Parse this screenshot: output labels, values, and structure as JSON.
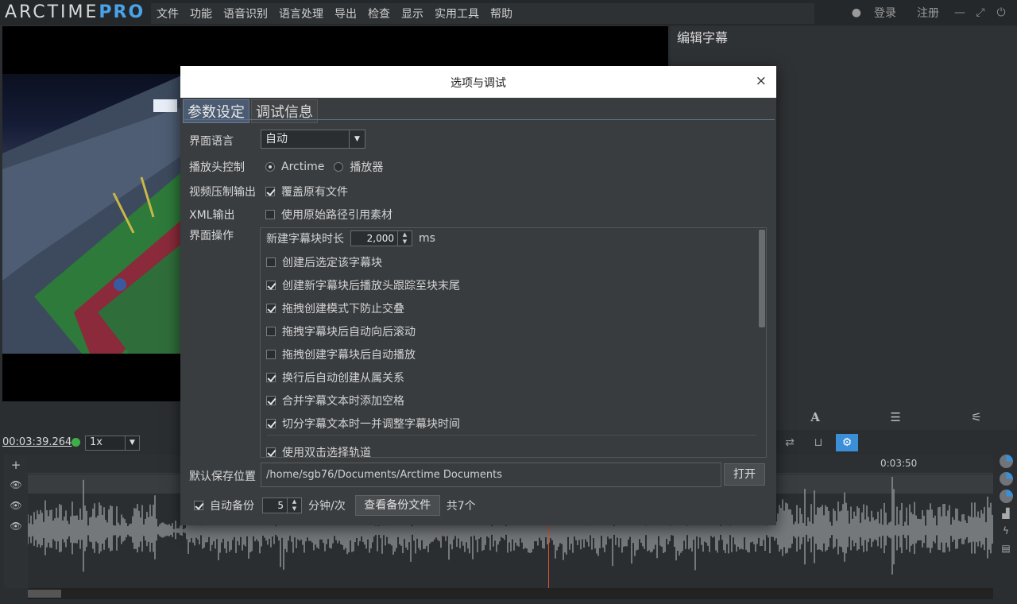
{
  "app": {
    "logo_text": "ARCTIME",
    "logo_pro": "PRO",
    "menu": [
      "文件",
      "功能",
      "语音识别",
      "语言处理",
      "导出",
      "检查",
      "显示",
      "实用工具",
      "帮助"
    ],
    "login": "登录",
    "register": "注册",
    "accent": "#3b8fd8"
  },
  "right_panel": {
    "title": "编辑字幕"
  },
  "playback": {
    "timecode": "00:03:39.264",
    "speed": "1x"
  },
  "timeline": {
    "ruler_label": "0:03:50"
  },
  "dialog": {
    "title": "选项与调试",
    "close": "×",
    "tabs": [
      "参数设定",
      "调试信息"
    ],
    "ui_language": {
      "label": "界面语言",
      "value": "自动"
    },
    "playhead_control": {
      "label": "播放头控制",
      "options": [
        "Arctime",
        "播放器"
      ],
      "selected": "Arctime"
    },
    "video_export": {
      "label": "视频压制输出",
      "option": "覆盖原有文件",
      "checked": true
    },
    "xml_export": {
      "label": "XML输出",
      "option": "使用原始路径引用素材",
      "checked": false
    },
    "ui_ops": {
      "label": "界面操作",
      "duration_label": "新建字幕块时长",
      "duration_value": "2,000",
      "duration_unit": "ms",
      "items": [
        {
          "text": "创建后选定该字幕块",
          "checked": false
        },
        {
          "text": "创建新字幕块后播放头跟踪至块末尾",
          "checked": true
        },
        {
          "text": "拖拽创建模式下防止交叠",
          "checked": true
        },
        {
          "text": "拖拽字幕块后自动向后滚动",
          "checked": false
        },
        {
          "text": "拖拽创建字幕块后自动播放",
          "checked": false
        },
        {
          "text": "换行后自动创建从属关系",
          "checked": true
        },
        {
          "text": "合并字幕文本时添加空格",
          "checked": true
        },
        {
          "text": "切分字幕文本时一并调整字幕块时间",
          "checked": true
        },
        {
          "text": "使用双击选择轨道",
          "checked": true
        }
      ]
    },
    "save_location": {
      "label": "默认保存位置",
      "path": "/home/sgb76/Documents/Arctime Documents",
      "open_btn": "打开"
    },
    "backup": {
      "label": "自动备份",
      "checked": true,
      "interval": "5",
      "unit": "分钟/次",
      "view_btn": "查看备份文件",
      "count": "共7个"
    }
  }
}
